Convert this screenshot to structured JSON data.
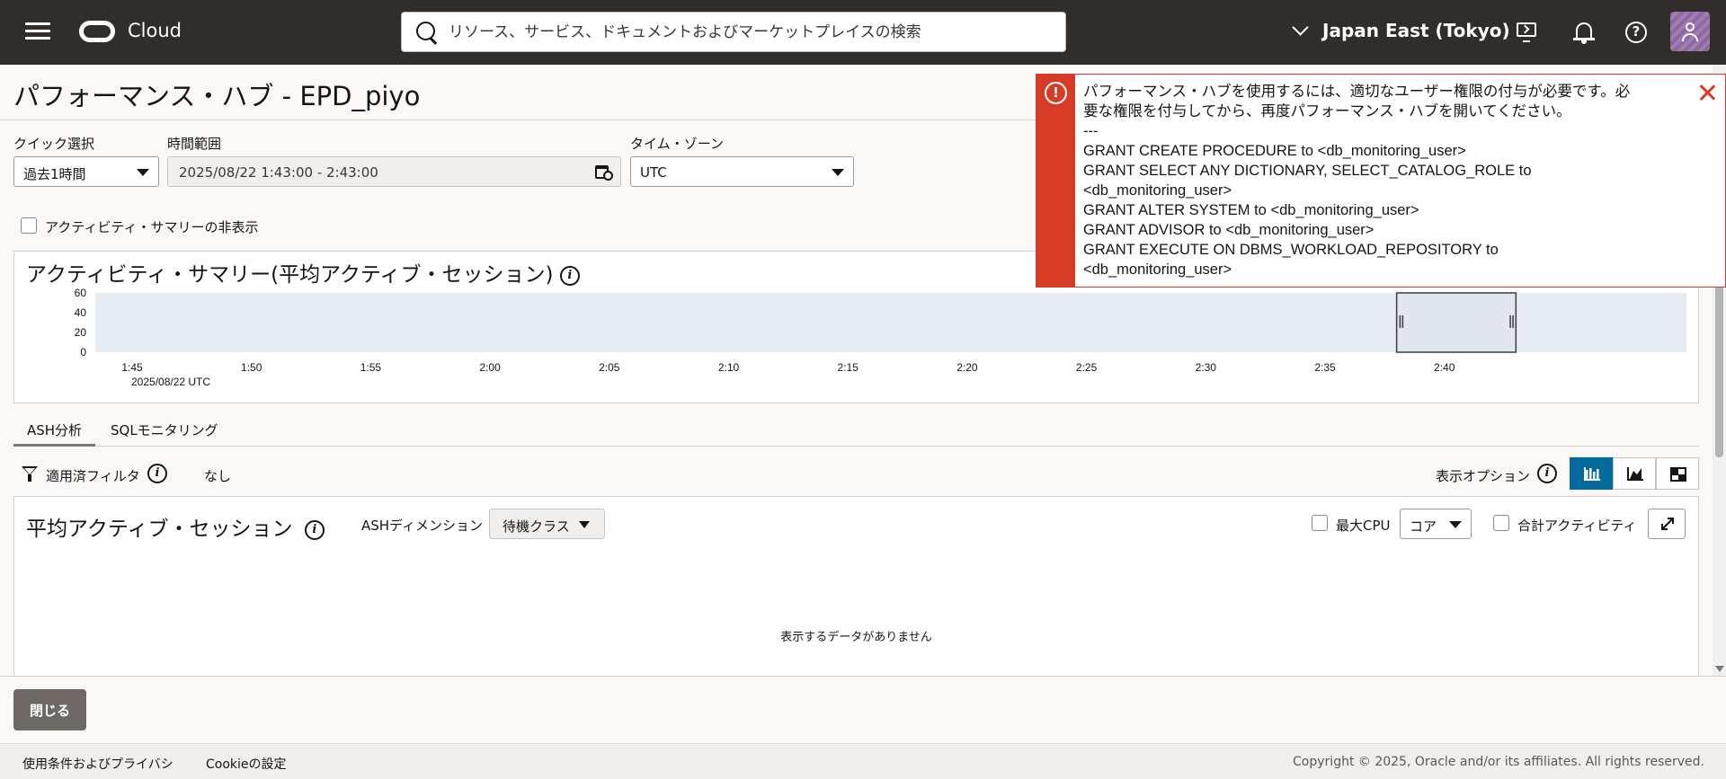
{
  "header": {
    "brand": "Cloud",
    "search_placeholder": "リソース、サービス、ドキュメントおよびマーケットプレイスの検索",
    "region": "Japan East (Tokyo)"
  },
  "page": {
    "title": "パフォーマンス・ハブ - EPD_piyo"
  },
  "controls": {
    "quick_select_label": "クイック選択",
    "quick_select_value": "過去1時間",
    "time_range_label": "時間範囲",
    "time_range_value": "2025/08/22 1:43:00 - 2:43:00",
    "timezone_label": "タイム・ゾーン",
    "timezone_value": "UTC",
    "hide_summary_label": "アクティビティ・サマリーの非表示"
  },
  "activity_summary": {
    "title": "アクティビティ・サマリー(平均アクティブ・セッション)",
    "date_label": "2025/08/22 UTC"
  },
  "chart_data": {
    "type": "area",
    "title": "アクティビティ・サマリー(平均アクティブ・セッション)",
    "y_ticks": [
      "60",
      "40",
      "20",
      "0"
    ],
    "ylim": [
      0,
      60
    ],
    "x_ticks": [
      "1:45",
      "1:50",
      "1:55",
      "2:00",
      "2:05",
      "2:10",
      "2:15",
      "2:20",
      "2:25",
      "2:30",
      "2:35",
      "2:40"
    ],
    "xlabel": "2025/08/22 UTC",
    "series": [],
    "selection_range": [
      "2:38",
      "2:43"
    ]
  },
  "tabs": [
    {
      "label": "ASH分析",
      "active": true
    },
    {
      "label": "SQLモニタリング",
      "active": false
    }
  ],
  "filter_bar": {
    "label": "適用済フィルタ",
    "value": "なし",
    "display_options_label": "表示オプション"
  },
  "aas": {
    "title": "平均アクティブ・セッション",
    "dimension_label": "ASHディメンション",
    "dimension_value": "待機クラス",
    "max_cpu_label": "最大CPU",
    "core_value": "コア",
    "total_activity_label": "合計アクティビティ",
    "no_data": "表示するデータがありません"
  },
  "actions": {
    "close_label": "閉じる"
  },
  "footer": {
    "terms": "使用条件およびプライバシ",
    "cookie": "Cookieの設定",
    "copyright": "Copyright © 2025, Oracle and/or its affiliates. All rights reserved."
  },
  "toast": {
    "lines": [
      "パフォーマンス・ハブを使用するには、適切なユーザー権限の付与が必要です。必",
      "要な権限を付与してから、再度パフォーマンス・ハブを開いてください。",
      "---",
      "GRANT CREATE PROCEDURE to <db_monitoring_user>",
      "GRANT SELECT ANY DICTIONARY, SELECT_CATALOG_ROLE to",
      "<db_monitoring_user>",
      "GRANT ALTER SYSTEM to <db_monitoring_user>",
      "GRANT ADVISOR to <db_monitoring_user>",
      "GRANT EXECUTE ON DBMS_WORKLOAD_REPOSITORY to",
      "<db_monitoring_user>"
    ],
    "color": "#d63b25"
  },
  "colors": {
    "header_bg": "#312d2a",
    "accent": "#036a9e",
    "error": "#d63b25"
  }
}
